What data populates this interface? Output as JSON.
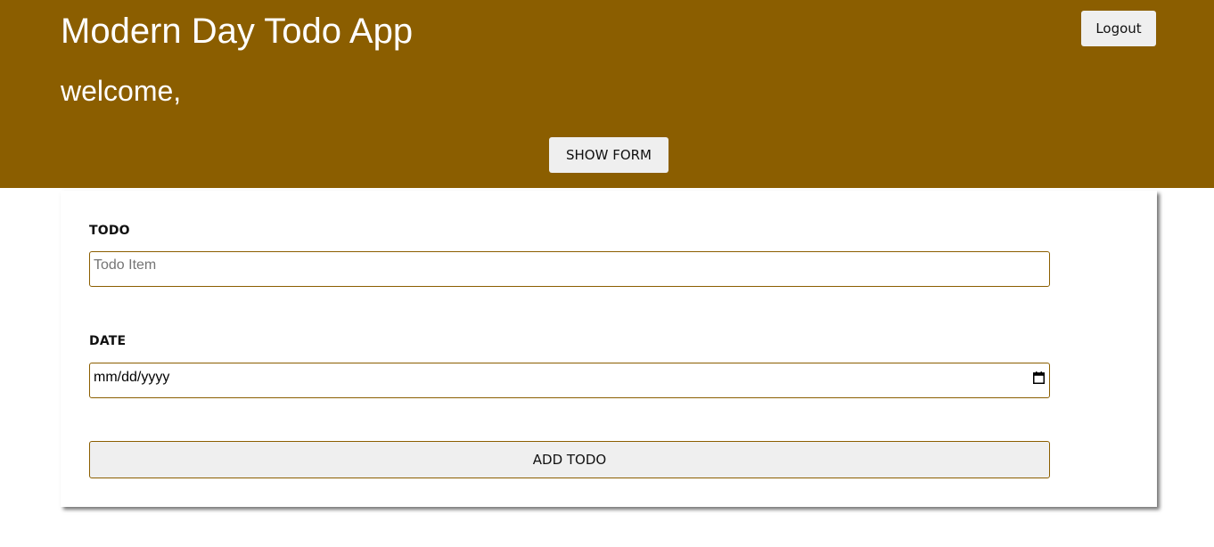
{
  "header": {
    "title": "Modern Day Todo App",
    "welcome": "welcome,",
    "logout_label": "Logout",
    "show_form_label": "SHOW FORM"
  },
  "form": {
    "todo_label": "TODO",
    "todo_placeholder": "Todo Item",
    "todo_value": "",
    "date_label": "DATE",
    "date_placeholder": "mm/dd/yyyy",
    "add_label": "ADD TODO"
  },
  "icons": {
    "calendar": "calendar-icon"
  },
  "colors": {
    "brand": "#8b5e00",
    "button_bg": "#efefef",
    "text_light": "#ffffff"
  }
}
